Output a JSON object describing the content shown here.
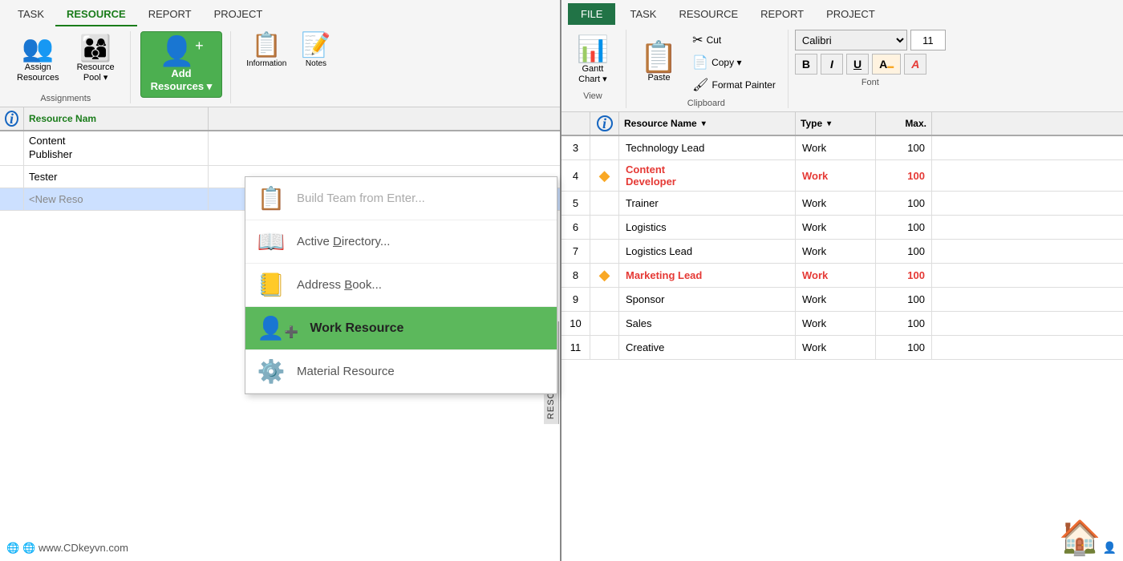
{
  "left": {
    "tabs": [
      {
        "label": "TASK",
        "active": false
      },
      {
        "label": "RESOURCE",
        "active": true
      },
      {
        "label": "REPORT",
        "active": false
      },
      {
        "label": "PROJECT",
        "active": false
      }
    ],
    "ribbon": {
      "assign_label": "Assign\nResources",
      "resource_pool_label": "Resource\nPool",
      "add_resources_label": "Add\nResources",
      "information_label": "Information",
      "notes_label": "Notes",
      "assignments_label": "Assignments"
    },
    "grid_header": [
      {
        "label": "ℹ",
        "key": "info"
      },
      {
        "label": "Resource Nam",
        "key": "name"
      }
    ],
    "rows": [
      {
        "info": "",
        "name": "Content\nPublisher"
      },
      {
        "info": "",
        "name": "Tester"
      },
      {
        "info": "",
        "name": "<New Reso",
        "new": true
      }
    ],
    "dropdown": {
      "items": [
        {
          "icon": "📋",
          "label": "Build Team from Enter...",
          "highlighted": false,
          "grayed": true
        },
        {
          "icon": "📖",
          "label": "Active Directory...",
          "highlighted": false,
          "grayed": false,
          "underline": "D"
        },
        {
          "icon": "📒",
          "label": "Address Book...",
          "highlighted": false,
          "grayed": false,
          "underline": "B"
        },
        {
          "icon": "👤",
          "label": "Work Resource",
          "highlighted": true,
          "grayed": false
        },
        {
          "icon": "⚙",
          "label": "Material Resource",
          "highlighted": false,
          "grayed": false
        }
      ]
    },
    "rotated_label": "RESOURCE SHEET",
    "watermark": "🌐 www.CDkeyvn.com"
  },
  "right": {
    "tabs": [
      {
        "label": "FILE",
        "active": false,
        "file": true
      },
      {
        "label": "TASK",
        "active": false
      },
      {
        "label": "RESOURCE",
        "active": false
      },
      {
        "label": "REPORT",
        "active": false
      },
      {
        "label": "PROJECT",
        "active": false
      }
    ],
    "clipboard": {
      "paste_label": "Paste",
      "cut_label": "Cut",
      "copy_label": "Copy",
      "format_painter_label": "Format Painter",
      "group_label": "Clipboard"
    },
    "font": {
      "family": "Calibri",
      "size": "11",
      "bold": "B",
      "italic": "I",
      "underline": "U",
      "highlight": "A",
      "color": "A",
      "group_label": "Font"
    },
    "view": {
      "gantt_label": "Gantt\nChart",
      "view_label": "View"
    },
    "grid_headers": [
      {
        "label": "ℹ",
        "key": "info"
      },
      {
        "label": "",
        "key": "warn"
      },
      {
        "label": "Resource Name",
        "key": "name"
      },
      {
        "label": "Type",
        "key": "type"
      },
      {
        "label": "Max.",
        "key": "max"
      }
    ],
    "rows": [
      {
        "num": "3",
        "warn": false,
        "name": "Technology Lead",
        "type": "Work",
        "max": "100",
        "overalloc": false
      },
      {
        "num": "4",
        "warn": true,
        "name": "Content Developer",
        "type": "Work",
        "max": "100",
        "overalloc": true
      },
      {
        "num": "5",
        "warn": false,
        "name": "Trainer",
        "type": "Work",
        "max": "100",
        "overalloc": false
      },
      {
        "num": "6",
        "warn": false,
        "name": "Logistics",
        "type": "Work",
        "max": "100",
        "overalloc": false
      },
      {
        "num": "7",
        "warn": false,
        "name": "Logistics Lead",
        "type": "Work",
        "max": "100",
        "overalloc": false
      },
      {
        "num": "8",
        "warn": true,
        "name": "Marketing Lead",
        "type": "Work",
        "max": "100",
        "overalloc": true
      },
      {
        "num": "9",
        "warn": false,
        "name": "Sponsor",
        "type": "Work",
        "max": "100",
        "overalloc": false
      },
      {
        "num": "10",
        "warn": false,
        "name": "Sales",
        "type": "Work",
        "max": "100",
        "overalloc": false
      },
      {
        "num": "11",
        "warn": false,
        "name": "Creative",
        "type": "Work",
        "max": "100",
        "overalloc": false
      }
    ]
  }
}
